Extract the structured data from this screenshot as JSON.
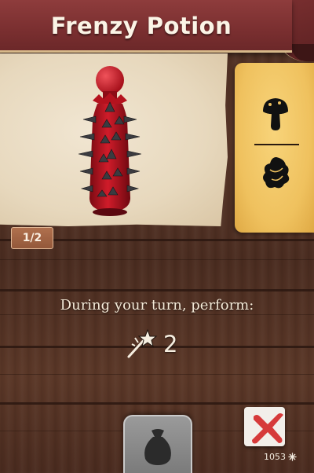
{
  "card": {
    "title": "Frenzy Potion",
    "item_icon": "spiked-red-potion-bottle",
    "page_counter": "1/2"
  },
  "side_panel": {
    "top_icon": "mushroom-icon",
    "bottom_icon": "foliage-icon"
  },
  "effect": {
    "rule_text": "During your turn, perform:",
    "action_icon": "magic-wand-icon",
    "action_value": "2"
  },
  "footer": {
    "bag_icon": "bag-icon",
    "dismiss_icon": "red-x-icon",
    "version": "1053",
    "version_icon": "snowflake-icon"
  },
  "colors": {
    "banner": "#7a2f30",
    "parchment": "#e7d8bd",
    "side_card": "#efc15e",
    "wood": "#4f3022",
    "potion_red": "#b3101c",
    "dismiss_red": "#d63a3a"
  }
}
